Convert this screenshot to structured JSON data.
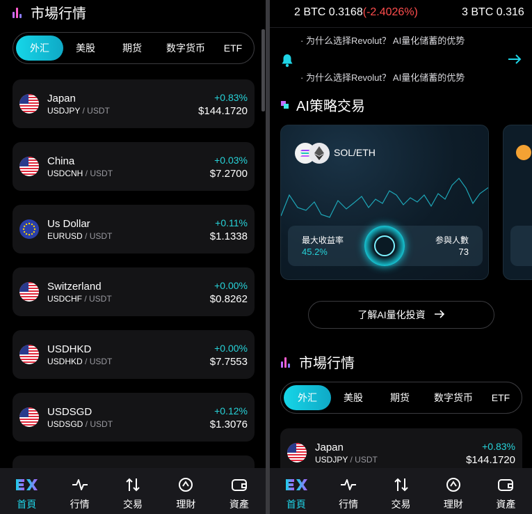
{
  "left": {
    "section_title": "市場行情",
    "tabs": [
      {
        "label": "外汇",
        "active": true
      },
      {
        "label": "美股",
        "active": false
      },
      {
        "label": "期货",
        "active": false
      },
      {
        "label": "数字货币",
        "active": false
      },
      {
        "label": "ETF",
        "active": false
      }
    ],
    "rows": [
      {
        "name": "Japan",
        "base": "USDJPY",
        "quote": "USDT",
        "change": "+0.83%",
        "price": "$144.1720",
        "flag": "us"
      },
      {
        "name": "China",
        "base": "USDCNH",
        "quote": "USDT",
        "change": "+0.03%",
        "price": "$7.2700",
        "flag": "us"
      },
      {
        "name": "Us Dollar",
        "base": "EURUSD",
        "quote": "USDT",
        "change": "+0.11%",
        "price": "$1.1338",
        "flag": "eu"
      },
      {
        "name": "Switzerland",
        "base": "USDCHF",
        "quote": "USDT",
        "change": "+0.00%",
        "price": "$0.8262",
        "flag": "us"
      },
      {
        "name": "USDHKD",
        "base": "USDHKD",
        "quote": "USDT",
        "change": "+0.00%",
        "price": "$7.7553",
        "flag": "us"
      },
      {
        "name": "USDSGD",
        "base": "USDSGD",
        "quote": "USDT",
        "change": "+0.12%",
        "price": "$1.3076",
        "flag": "us"
      }
    ]
  },
  "nav": [
    {
      "label": "首頁",
      "icon": "ex-logo-icon",
      "active": true
    },
    {
      "label": "行情",
      "icon": "pulse-icon",
      "active": false
    },
    {
      "label": "交易",
      "icon": "swap-arrows-icon",
      "active": false
    },
    {
      "label": "理財",
      "icon": "finance-icon",
      "active": false
    },
    {
      "label": "資產",
      "icon": "wallet-icon",
      "active": false
    }
  ],
  "right": {
    "ticker": {
      "item1_label": "2 BTC 0.3168",
      "item1_change": "(-2.4026%)",
      "item2_label": "3 BTC 0.316"
    },
    "notice": {
      "line_top": "· 为什么选择Revolut？ AI量化储蓄的优势",
      "line_bottom": "· 为什么选择Revolut？ AI量化储蓄的优势"
    },
    "ai_title": "AI策略交易",
    "ai_card": {
      "pair": "SOL/ETH",
      "max_return_label": "最大收益率",
      "max_return_value": "45.2%",
      "participants_label": "参與人數",
      "participants_value": "73"
    },
    "learn_button": "了解AI量化投資",
    "section_title": "市場行情",
    "tabs": [
      {
        "label": "外汇",
        "active": true
      },
      {
        "label": "美股",
        "active": false
      },
      {
        "label": "期货",
        "active": false
      },
      {
        "label": "数字货币",
        "active": false
      },
      {
        "label": "ETF",
        "active": false
      }
    ],
    "row": {
      "name": "Japan",
      "base": "USDJPY",
      "quote": "USDT",
      "change": "+0.83%",
      "price": "$144.1720"
    }
  },
  "colors": {
    "accent": "#1fd4e6",
    "up": "#27d3d9",
    "down": "#ff4d4d",
    "card": "#141416",
    "nav_bg": "#19191d"
  }
}
